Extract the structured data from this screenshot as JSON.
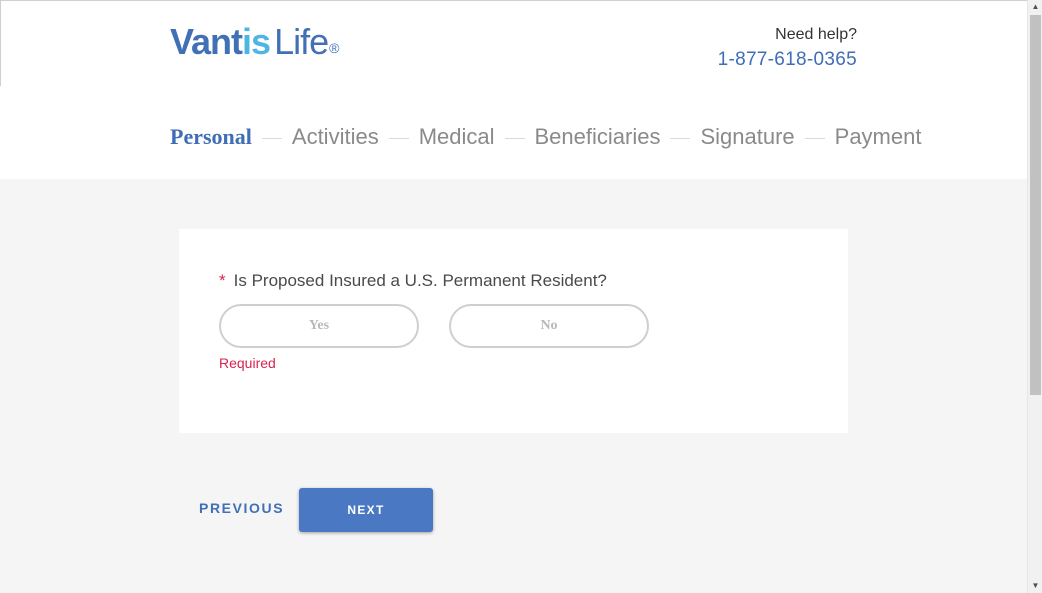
{
  "brand": {
    "part1": "Vant",
    "part2": "is",
    "part3": "Life",
    "registered": "®",
    "colors": {
      "primary": "#4170b5",
      "secondary": "#4fb6e3"
    }
  },
  "help": {
    "label": "Need help?",
    "phone": "1-877-618-0365"
  },
  "steps": [
    {
      "label": "Personal",
      "active": true
    },
    {
      "label": "Activities",
      "active": false
    },
    {
      "label": "Medical",
      "active": false
    },
    {
      "label": "Beneficiaries",
      "active": false
    },
    {
      "label": "Signature",
      "active": false
    },
    {
      "label": "Payment",
      "active": false
    }
  ],
  "form": {
    "required_marker": "*",
    "question": "Is Proposed Insured a U.S. Permanent Resident?",
    "options": {
      "yes": "Yes",
      "no": "No"
    },
    "error": "Required"
  },
  "actions": {
    "previous": "PREVIOUS",
    "next": "NEXT"
  },
  "scrollbar": {
    "up_glyph": "▲",
    "down_glyph": "▼"
  },
  "colors": {
    "accent": "#4a78c2",
    "error": "#d6254f",
    "page_bg": "#f5f5f5"
  }
}
